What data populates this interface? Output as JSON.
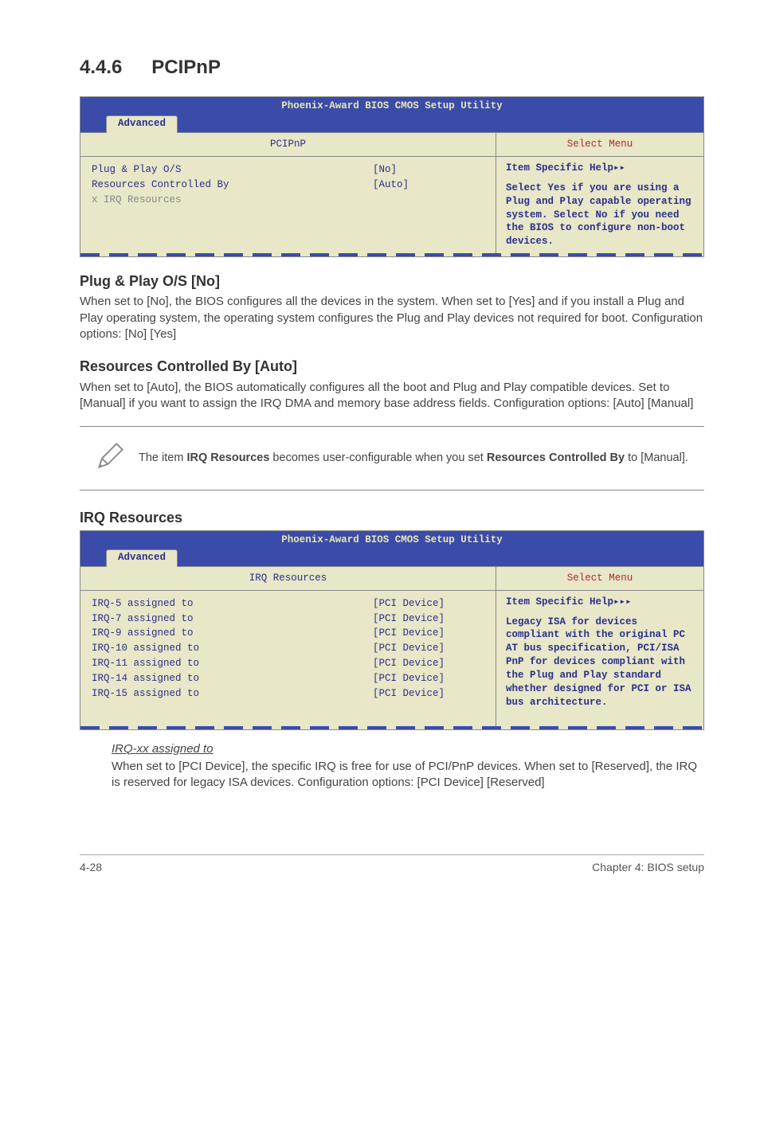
{
  "section": {
    "num": "4.4.6",
    "title": "PCIPnP"
  },
  "bios1": {
    "title": "Phoenix-Award BIOS CMOS Setup Utility",
    "tab": "Advanced",
    "panel_title": "PCIPnP",
    "select_menu": "Select Menu",
    "lines": [
      {
        "lbl": "Plug & Play O/S",
        "val": "[No]",
        "disabled": false
      },
      {
        "lbl": "Resources Controlled By",
        "val": "[Auto]",
        "disabled": false
      },
      {
        "lbl": "x  IRQ Resources",
        "val": "",
        "disabled": true
      }
    ],
    "help_title": "Item Specific Help",
    "help_body": "Select Yes if you are using a Plug and Play capable operating system. Select No if you need the BIOS to configure non-boot devices."
  },
  "sub1": {
    "heading": "Plug & Play O/S [No]",
    "body": "When set to [No], the BIOS configures all the devices in the system. When set to [Yes] and if you install a Plug and Play operating system, the operating system configures the Plug and Play devices not required for boot. Configuration options: [No] [Yes]"
  },
  "sub2": {
    "heading": "Resources Controlled By [Auto]",
    "body": "When set to [Auto], the BIOS automatically configures all the boot and Plug and Play compatible devices. Set to [Manual] if you want to assign the IRQ DMA and memory base address fields. Configuration options: [Auto] [Manual]"
  },
  "note": {
    "pre": "The item ",
    "bold1": "IRQ Resources",
    "mid": " becomes user-configurable when you set ",
    "bold2": "Resources Controlled By",
    "post": " to [Manual]."
  },
  "sub3": {
    "heading": "IRQ Resources"
  },
  "bios2": {
    "title": "Phoenix-Award BIOS CMOS Setup Utility",
    "tab": "Advanced",
    "panel_title": "IRQ Resources",
    "select_menu": "Select Menu",
    "lines": [
      {
        "lbl": "IRQ-5 assigned to",
        "val": "[PCI Device]"
      },
      {
        "lbl": "IRQ-7 assigned to",
        "val": "[PCI Device]"
      },
      {
        "lbl": "IRQ-9 assigned to",
        "val": "[PCI Device]"
      },
      {
        "lbl": "IRQ-10 assigned to",
        "val": "[PCI Device]"
      },
      {
        "lbl": "IRQ-11 assigned to",
        "val": "[PCI Device]"
      },
      {
        "lbl": "IRQ-14 assigned to",
        "val": "[PCI Device]"
      },
      {
        "lbl": "IRQ-15 assigned to",
        "val": "[PCI Device]"
      }
    ],
    "help_title": "Item Specific Help",
    "help_body": "Legacy ISA for devices compliant with the original PC AT bus specification, PCI/ISA PnP for devices compliant with the Plug and Play standard whether designed for PCI or ISA bus architecture."
  },
  "irq": {
    "head": "IRQ-xx assigned to",
    "body": "When set to [PCI Device], the specific IRQ is free for use of PCI/PnP devices. When set to [Reserved], the IRQ is reserved for legacy ISA devices. Configuration options: [PCI Device] [Reserved]"
  },
  "footer": {
    "left": "4-28",
    "right": "Chapter 4: BIOS setup"
  }
}
